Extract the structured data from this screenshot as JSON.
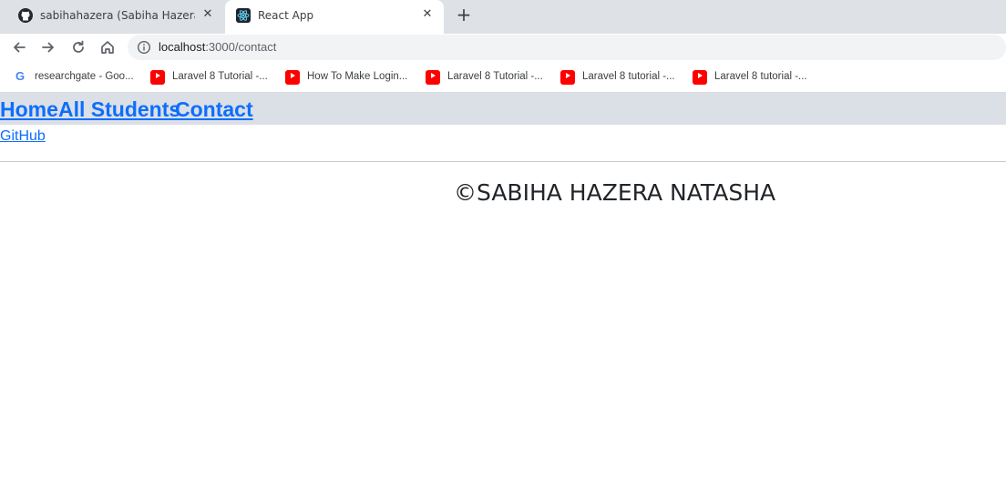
{
  "browser": {
    "tabs": [
      {
        "title": "sabihahazera (Sabiha Hazera )",
        "icon": "github-icon",
        "active": false
      },
      {
        "title": "React App",
        "icon": "react-icon",
        "active": true
      }
    ],
    "close_glyph": "✕",
    "new_tab_glyph": "+",
    "url_host": "localhost",
    "url_path": ":3000/contact",
    "bookmarks": [
      {
        "label": "researchgate - Goo...",
        "icon": "google-icon"
      },
      {
        "label": "Laravel 8 Tutorial -...",
        "icon": "youtube-icon"
      },
      {
        "label": "How To Make Login...",
        "icon": "youtube-icon"
      },
      {
        "label": "Laravel 8 Tutorial -...",
        "icon": "youtube-icon"
      },
      {
        "label": "Laravel 8 tutorial -...",
        "icon": "youtube-icon"
      },
      {
        "label": "Laravel 8 tutorial -...",
        "icon": "youtube-icon"
      }
    ]
  },
  "page": {
    "nav": {
      "home": "Home",
      "students": "All Students",
      "contact": "Contact"
    },
    "github_link": "GitHub",
    "copyright": "©SABIHA HAZERA NATASHA"
  },
  "colors": {
    "link": "#0d6efd",
    "navbar_bg": "#dbdfe6",
    "tabstrip_bg": "#dee1e6"
  }
}
